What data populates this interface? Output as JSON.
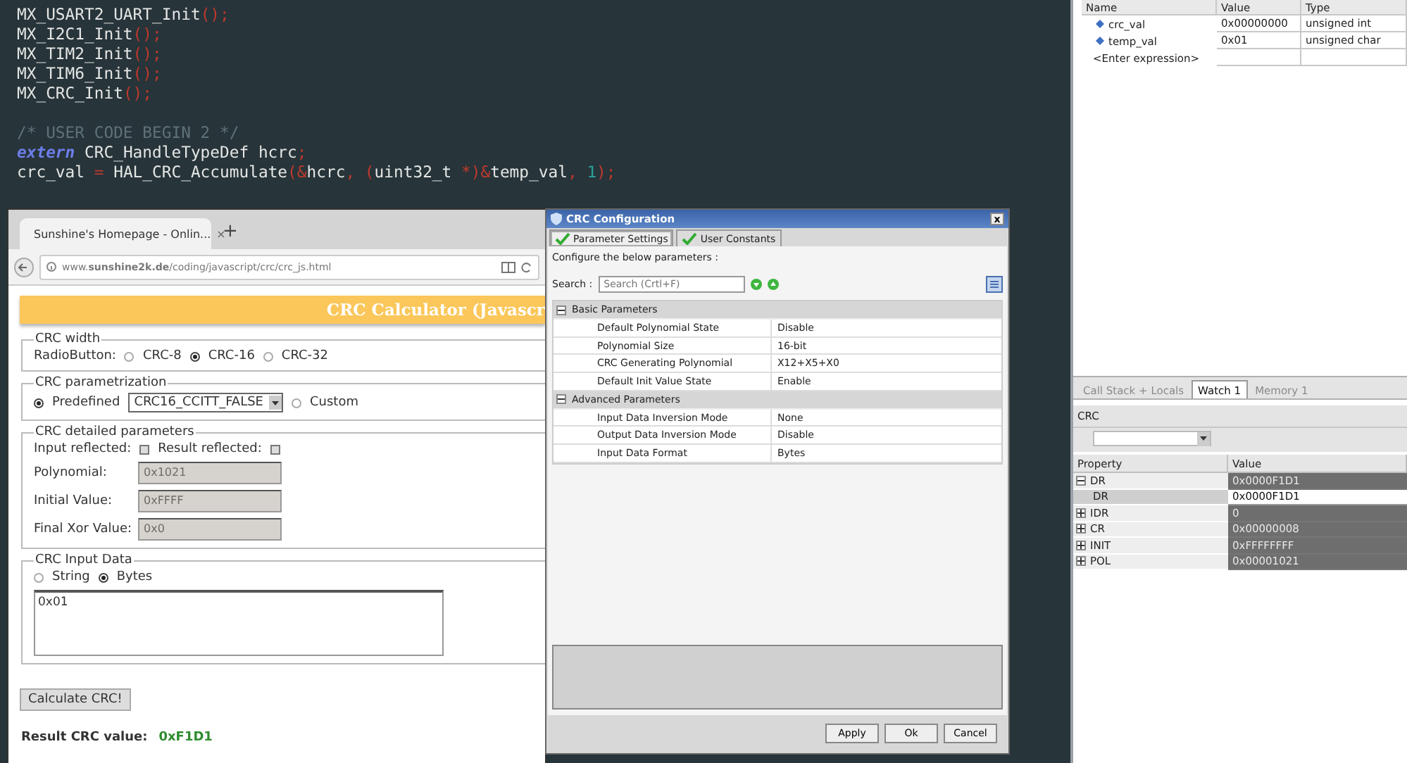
{
  "editor": {
    "blocks": [
      [
        {
          "tokens": [
            {
              "text": "MX_USART2_UART_Init",
              "kind": "plain"
            },
            {
              "text": "();",
              "kind": "punct"
            }
          ]
        },
        {
          "tokens": [
            {
              "text": "MX_I2C1_Init",
              "kind": "plain"
            },
            {
              "text": "();",
              "kind": "punct"
            }
          ]
        },
        {
          "tokens": [
            {
              "text": "MX_TIM2_Init",
              "kind": "plain"
            },
            {
              "text": "();",
              "kind": "punct"
            }
          ]
        },
        {
          "tokens": [
            {
              "text": "MX_TIM6_Init",
              "kind": "plain"
            },
            {
              "text": "();",
              "kind": "punct"
            }
          ]
        },
        {
          "tokens": [
            {
              "text": "MX_CRC_Init",
              "kind": "plain"
            },
            {
              "text": "();",
              "kind": "punct"
            }
          ]
        }
      ],
      [
        {
          "tokens": [
            {
              "text": "/* USER CODE BEGIN 2 */",
              "kind": "comment"
            }
          ]
        },
        {
          "tokens": [
            {
              "text": "extern",
              "kind": "keyword"
            },
            {
              "text": " CRC_HandleTypeDef hcrc",
              "kind": "plain"
            },
            {
              "text": ";",
              "kind": "punct"
            }
          ]
        },
        {
          "tokens": [
            {
              "text": "crc_val ",
              "kind": "plain"
            },
            {
              "text": "=",
              "kind": "punct"
            },
            {
              "text": " HAL_CRC_Accumulate",
              "kind": "plain"
            },
            {
              "text": "(&",
              "kind": "punct"
            },
            {
              "text": "hcrc",
              "kind": "plain"
            },
            {
              "text": ", (",
              "kind": "punct"
            },
            {
              "text": "uint32_t ",
              "kind": "plain"
            },
            {
              "text": "*)&",
              "kind": "punct"
            },
            {
              "text": "temp_val",
              "kind": "plain"
            },
            {
              "text": ", ",
              "kind": "punct"
            },
            {
              "text": "1",
              "kind": "number"
            },
            {
              "text": ");",
              "kind": "punct"
            }
          ]
        }
      ]
    ]
  },
  "browser": {
    "tab_title": "Sunshine's Homepage - Onlin...",
    "tab_close": "×",
    "new_tab": "+",
    "url": "www.**sunshine2k.de**/coding/javascript/crc/crc_js.html",
    "banner": "CRC Calculator (Javascr",
    "width": {
      "legend": "CRC width",
      "label": "RadioButton:",
      "options": [
        {
          "label": "CRC-8",
          "selected": false
        },
        {
          "label": "CRC-16",
          "selected": true
        },
        {
          "label": "CRC-32",
          "selected": false
        }
      ]
    },
    "parametrization": {
      "legend": "CRC parametrization",
      "options": [
        {
          "label": "Predefined",
          "selected": true,
          "kind": "select",
          "value": "CRC16_CCITT_FALSE"
        },
        {
          "label": "Custom",
          "selected": false,
          "kind": "plain"
        }
      ]
    },
    "detailed": {
      "legend": "CRC detailed parameters",
      "checks": [
        {
          "label": "Input reflected:",
          "checked": false
        },
        {
          "label": "Result reflected:",
          "checked": false
        }
      ],
      "fields": [
        {
          "label": "Polynomial:",
          "value": "0x1021",
          "disabled": true
        },
        {
          "label": "Initial Value:",
          "value": "0xFFFF",
          "disabled": true
        },
        {
          "label": "Final Xor Value:",
          "value": "0x0",
          "disabled": true
        }
      ]
    },
    "input": {
      "legend": "CRC Input Data",
      "options": [
        {
          "label": "String",
          "selected": false
        },
        {
          "label": "Bytes",
          "selected": true
        }
      ],
      "value": "0x01"
    },
    "button": "Calculate CRC!",
    "result_label": "Result CRC value:",
    "result_value": "0xF1D1"
  },
  "dialog": {
    "title": "CRC Configuration",
    "close": "x",
    "tabs": [
      {
        "label": "Parameter Settings",
        "selected": true
      },
      {
        "label": "User Constants",
        "selected": false
      }
    ],
    "hint": "Configure the below parameters :",
    "search_label": "Search :",
    "search_placeholder": "Search (Crtl+F)",
    "groups": [
      {
        "name": "Basic Parameters",
        "expanded": true,
        "rows": [
          {
            "name": "Default Polynomial State",
            "value": "Disable"
          },
          {
            "name": "Polynomial Size",
            "value": "16-bit"
          },
          {
            "name": "CRC Generating Polynomial",
            "value": "X12+X5+X0"
          },
          {
            "name": "Default Init Value State",
            "value": "Enable"
          }
        ]
      },
      {
        "name": "Advanced Parameters",
        "expanded": true,
        "rows": [
          {
            "name": "Input Data Inversion Mode",
            "value": "None"
          },
          {
            "name": "Output Data Inversion Mode",
            "value": "Disable"
          },
          {
            "name": "Input Data Format",
            "value": "Bytes"
          }
        ]
      }
    ],
    "buttons": [
      "Apply",
      "Ok",
      "Cancel"
    ]
  },
  "watch": {
    "columns": [
      "Name",
      "Value",
      "Type"
    ],
    "rows": [
      {
        "name": "crc_val",
        "value": "0x00000000",
        "type": "unsigned int"
      },
      {
        "name": "temp_val",
        "value": "0x01",
        "type": "unsigned char"
      }
    ],
    "enter": "<Enter expression>"
  },
  "registers": {
    "tabs": [
      {
        "label": "Call Stack + Locals",
        "selected": false
      },
      {
        "label": "Watch 1",
        "selected": true
      },
      {
        "label": "Memory 1",
        "selected": false
      }
    ],
    "title": "CRC",
    "columns": [
      "Property",
      "Value"
    ],
    "rows": [
      {
        "name": "DR",
        "value": "0x0000F1D1",
        "expanded": true,
        "selected": false,
        "children": [
          {
            "name": "DR",
            "value": "0x0000F1D1",
            "selected": true
          }
        ]
      },
      {
        "name": "IDR",
        "value": "0",
        "expanded": false,
        "selected": false
      },
      {
        "name": "CR",
        "value": "0x00000008",
        "expanded": false,
        "selected": false
      },
      {
        "name": "INIT",
        "value": "0xFFFFFFFF",
        "expanded": false,
        "selected": false
      },
      {
        "name": "POL",
        "value": "0x00001021",
        "expanded": false,
        "selected": false
      }
    ]
  }
}
